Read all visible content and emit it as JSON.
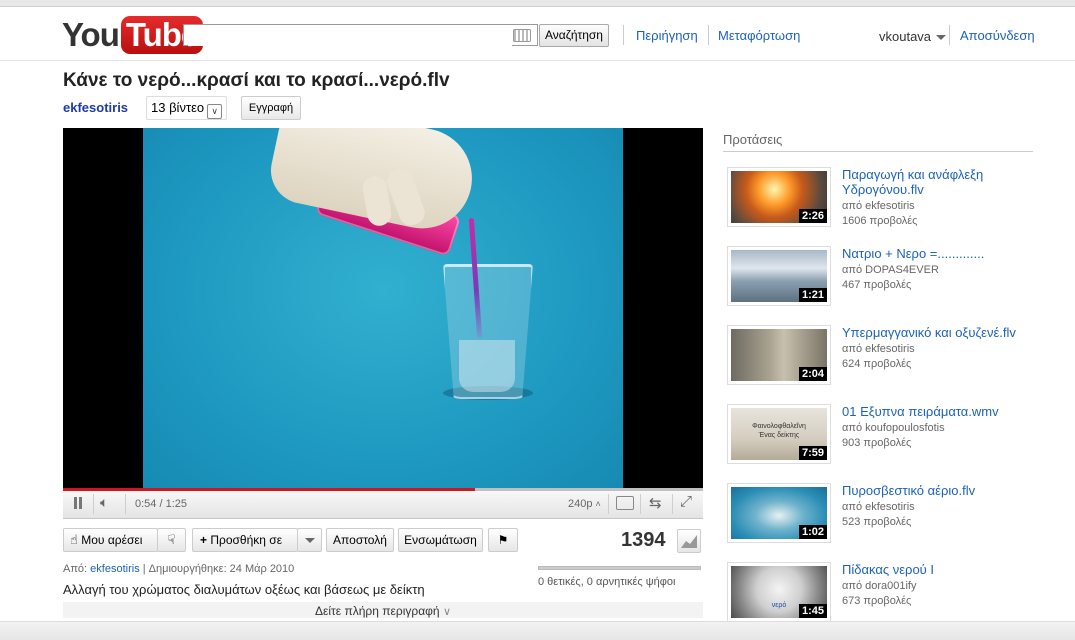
{
  "masthead": {
    "logo_you": "You",
    "logo_tube": "Tube",
    "search_placeholder": "",
    "search_button": "Αναζήτηση",
    "nav_browse": "Περιήγηση",
    "nav_upload": "Μεταφόρτωση",
    "username": "vkoutava",
    "signout": "Αποσύνδεση"
  },
  "video": {
    "title": "Κάνε το νερό...κρασί και το κρασί...νερό.flv",
    "channel": "ekfesotiris",
    "video_count": "13 βίντεο",
    "subscribe": "Εγγραφή",
    "progress_fraction": 0.643,
    "buffered_fraction": 0.643
  },
  "player_controls": {
    "time": "0:54 / 1:25",
    "quality": "240p"
  },
  "actions": {
    "like": "Μου αρέσει",
    "add_to": "Προσθήκη σε",
    "share": "Αποστολή",
    "embed": "Ενσωμάτωση",
    "view_count": "1394",
    "likes_text": "0 θετικές, 0 αρνητικές ψήφοι"
  },
  "info": {
    "by_label": "Από:",
    "uploader": "ekfesotiris",
    "created": "| Δημιουργήθηκε: 24 Μάρ 2010",
    "description": "Αλλαγή του χρώματος διαλυμάτων οξέως και βάσεως με δείκτη",
    "show_more": "Δείτε πλήρη περιγραφή"
  },
  "sidebar": {
    "title": "Προτάσεις",
    "items": [
      {
        "title": "Παραγωγή και ανάφλεξη Υδρογόνου.flv",
        "by": "από ekfesotiris",
        "views": "1606 προβολές",
        "duration": "2:26"
      },
      {
        "title": "Νατριο + Νερο =.............",
        "by": "από DOPAS4EVER",
        "views": "467 προβολές",
        "duration": "1:21"
      },
      {
        "title": "Υπερμαγγανικό και οξυζενέ.flv",
        "by": "από ekfesotiris",
        "views": "624 προβολές",
        "duration": "2:04"
      },
      {
        "title": "01 Εξυπνα πειράματα.wmv",
        "by": "από koufopoulosfotis",
        "views": "903 προβολές",
        "duration": "7:59",
        "thumb_caption_1": "Φαινολοφθαλεΐνη",
        "thumb_caption_2": "Ένας δείκτης"
      },
      {
        "title": "Πυροσβεστικό αέριο.flv",
        "by": "από ekfesotiris",
        "views": "523 προβολές",
        "duration": "1:02"
      },
      {
        "title": "Πίδακας νερού Ι",
        "by": "από dora001ify",
        "views": "673 προβολές",
        "duration": "1:45",
        "thumb_caption_1": "νερό"
      }
    ]
  }
}
